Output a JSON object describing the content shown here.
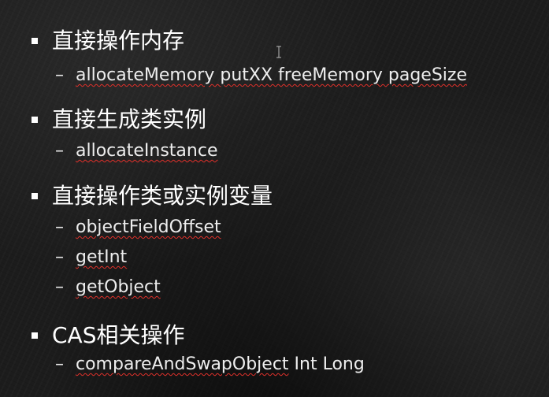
{
  "items": [
    {
      "heading": "直接操作内存",
      "subs": [
        [
          "allocateMemory putXX freeMemory pageSize"
        ]
      ]
    },
    {
      "heading": "直接生成类实例",
      "subs": [
        [
          "allocateInstance"
        ]
      ]
    },
    {
      "heading": "直接操作类或实例变量",
      "subs": [
        [
          "objectFieldOffset"
        ],
        [
          "getInt"
        ],
        [
          "getObject"
        ]
      ]
    },
    {
      "heading": "CAS相关操作",
      "subs": [
        [
          "compareAndSwapObject",
          " Int Long"
        ]
      ]
    }
  ],
  "dash_glyph": "–",
  "cursor_icon": "text-cursor-icon"
}
